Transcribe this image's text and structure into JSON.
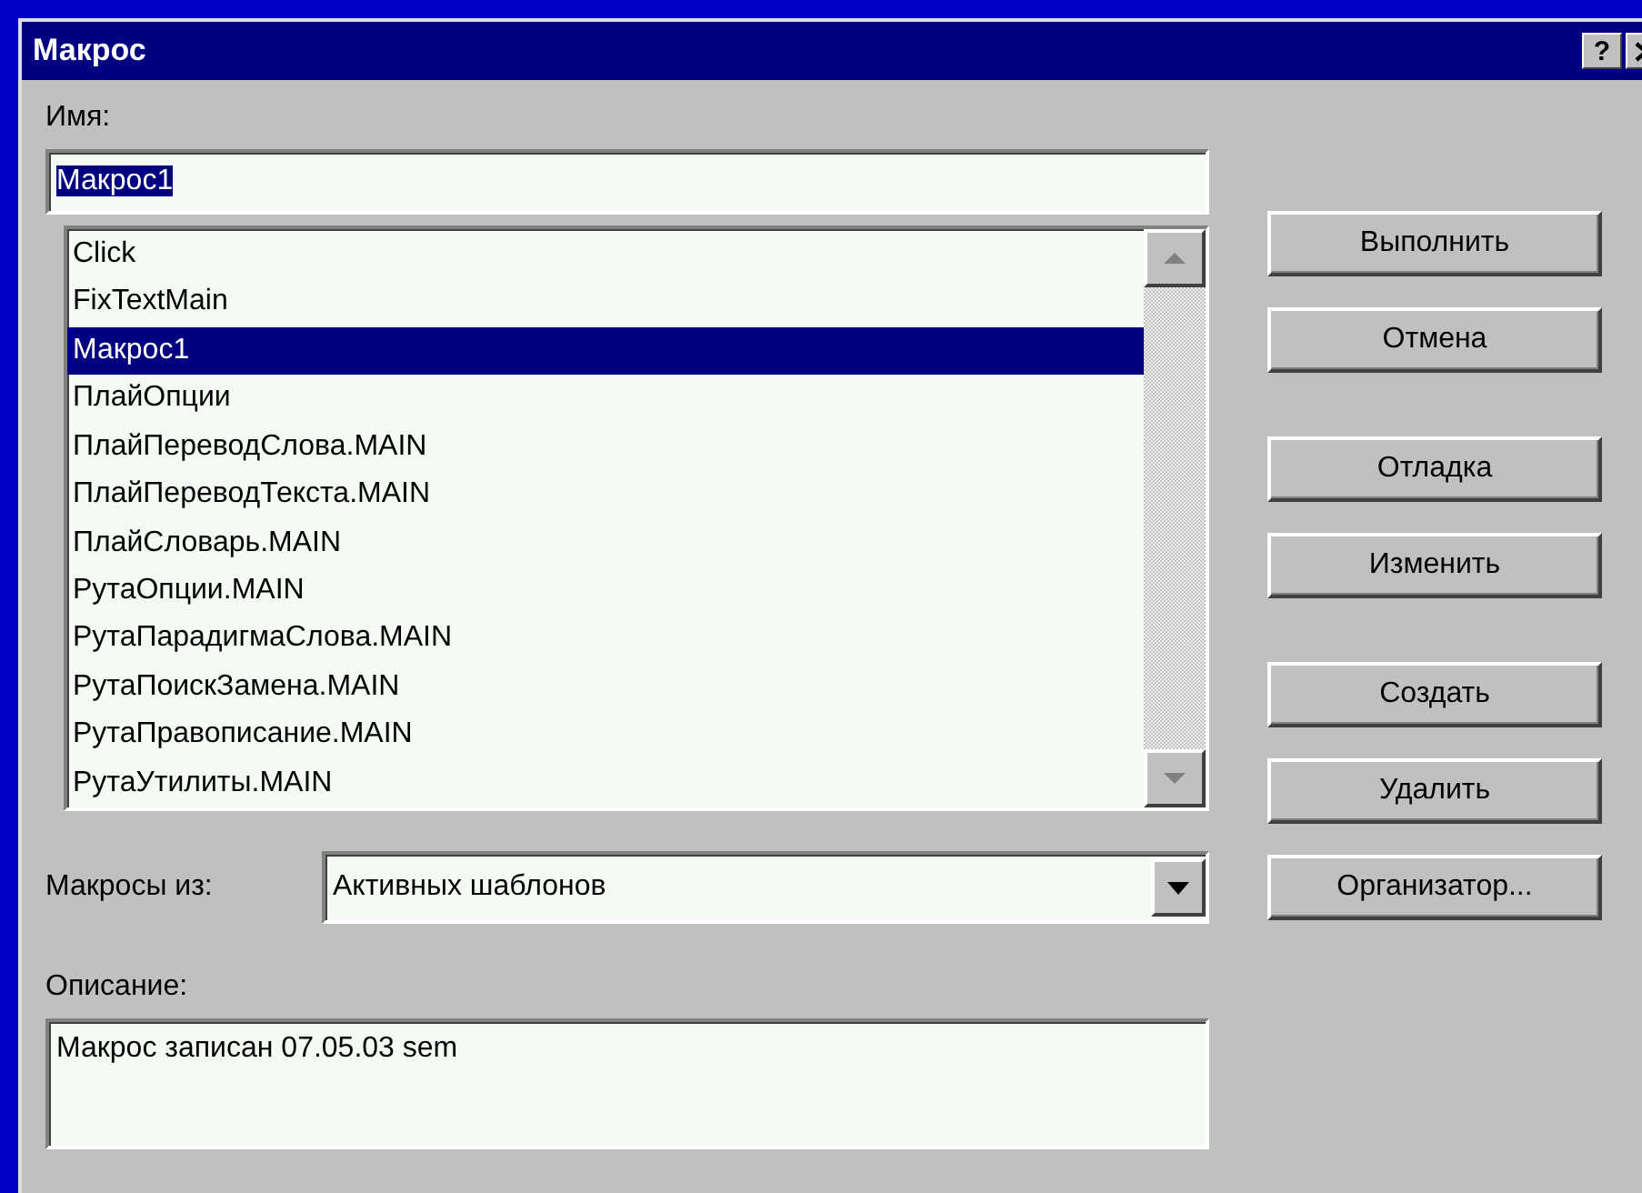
{
  "window": {
    "title": "Макрос",
    "help_button": "?"
  },
  "name_label": "Имя:",
  "name_field": {
    "value": "Макрос1",
    "text_selected": true
  },
  "macros": [
    {
      "label": "Click",
      "selected": false
    },
    {
      "label": "FixTextMain",
      "selected": false
    },
    {
      "label": "Макрос1",
      "selected": true
    },
    {
      "label": "ПлайОпции",
      "selected": false
    },
    {
      "label": "ПлайПереводСлова.MAIN",
      "selected": false
    },
    {
      "label": "ПлайПереводТекста.MAIN",
      "selected": false
    },
    {
      "label": "ПлайСловарь.MAIN",
      "selected": false
    },
    {
      "label": "РутаОпции.MAIN",
      "selected": false
    },
    {
      "label": "РутаПарадигмаСлова.MAIN",
      "selected": false
    },
    {
      "label": "РутаПоискЗамена.MAIN",
      "selected": false
    },
    {
      "label": "РутаПравописание.MAIN",
      "selected": false
    },
    {
      "label": "РутаУтилиты.MAIN",
      "selected": false
    }
  ],
  "macros_from": {
    "label": "Макросы из:",
    "value": "Активных шаблонов"
  },
  "description": {
    "label": "Описание:",
    "value": "Макрос записан 07.05.03 sem"
  },
  "button_groups": [
    [
      "Выполнить",
      "Отмена"
    ],
    [
      "Отладка",
      "Изменить"
    ],
    [
      "Создать",
      "Удалить",
      "Организатор..."
    ]
  ]
}
